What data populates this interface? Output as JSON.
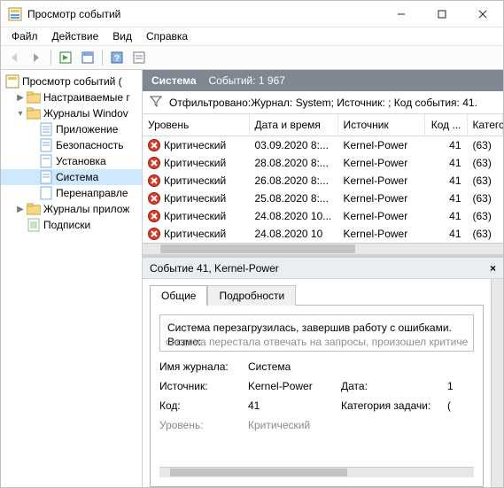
{
  "window": {
    "title": "Просмотр событий"
  },
  "menu": {
    "file": "Файл",
    "action": "Действие",
    "view": "Вид",
    "help": "Справка"
  },
  "tree": {
    "root": "Просмотр событий (",
    "custom": "Настраиваемые г",
    "winlogs": "Журналы Windov",
    "app": "Приложение",
    "security": "Безопасность",
    "setup": "Установка",
    "system": "Система",
    "forwarded": "Перенаправле",
    "applogs": "Журналы прилож",
    "subs": "Подписки"
  },
  "header": {
    "title": "Система",
    "count_label": "Событий: 1 967"
  },
  "filter": {
    "text": "Отфильтровано:Журнал: System; Источник: ; Код события: 41."
  },
  "columns": {
    "level": "Уровень",
    "date": "Дата и время",
    "source": "Источник",
    "id": "Код ...",
    "cat": "Катего"
  },
  "rows": [
    {
      "level": "Критический",
      "date": "03.09.2020 8:...",
      "source": "Kernel-Power",
      "id": "41",
      "cat": "(63)"
    },
    {
      "level": "Критический",
      "date": "28.08.2020 8:...",
      "source": "Kernel-Power",
      "id": "41",
      "cat": "(63)"
    },
    {
      "level": "Критический",
      "date": "26.08.2020 8:...",
      "source": "Kernel-Power",
      "id": "41",
      "cat": "(63)"
    },
    {
      "level": "Критический",
      "date": "25.08.2020 8:...",
      "source": "Kernel-Power",
      "id": "41",
      "cat": "(63)"
    },
    {
      "level": "Критический",
      "date": "24.08.2020 10...",
      "source": "Kernel-Power",
      "id": "41",
      "cat": "(63)"
    },
    {
      "level": "Критический",
      "date": "24.08.2020 10",
      "source": "Kernel-Power",
      "id": "41",
      "cat": "(63)"
    }
  ],
  "detail": {
    "pane_title": "Событие 41, Kernel-Power",
    "tab_general": "Общие",
    "tab_details": "Подробности",
    "message_line1": "Система перезагрузилась, завершив работу с ошибками. Возмо:",
    "message_line2": "система перестала отвечать на запросы, произошел критически",
    "k_log": "Имя журнала:",
    "v_log": "Система",
    "k_source": "Источник:",
    "v_source": "Kernel-Power",
    "k_id": "Код:",
    "v_id": "41",
    "k_date": "Дата:",
    "v_date": "1",
    "k_taskcat": "Категория задачи:",
    "v_taskcat": "(",
    "k_level_cut": "Уровень:",
    "v_level_cut": "Критический"
  }
}
